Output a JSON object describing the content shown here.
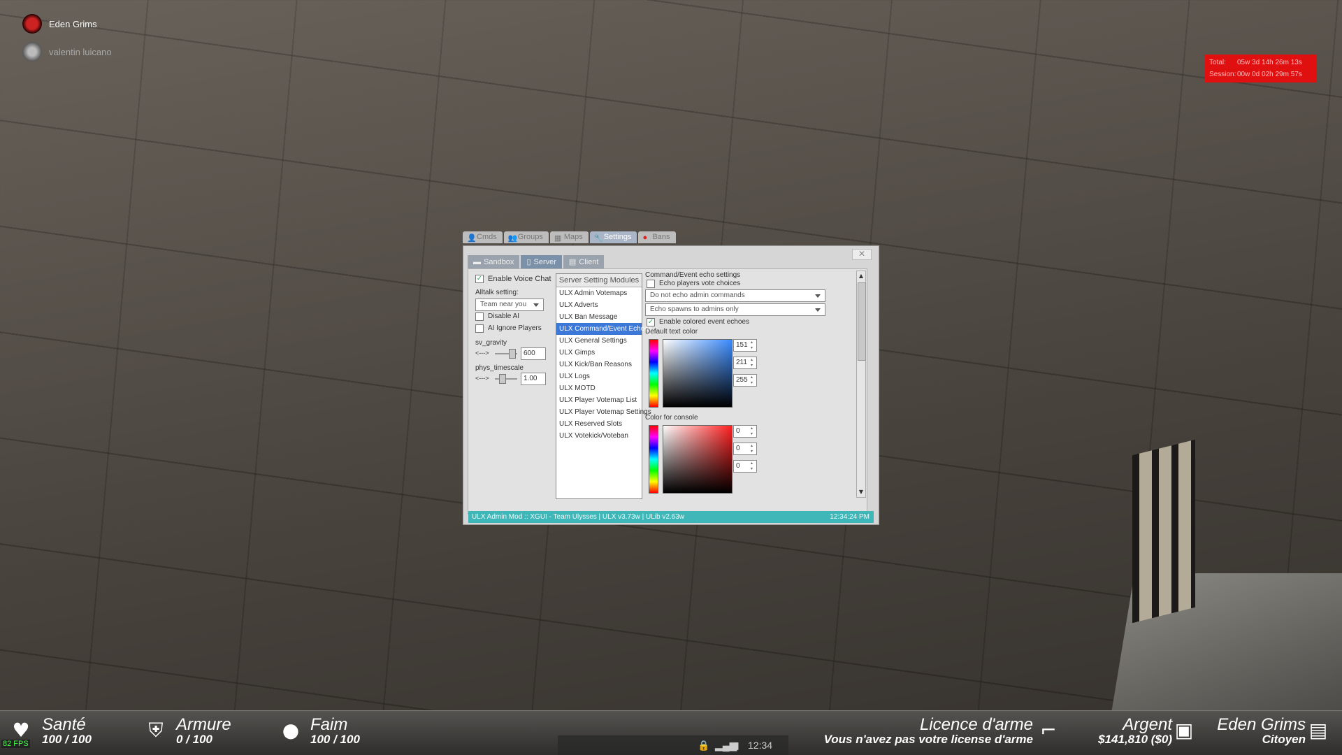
{
  "voice": {
    "speakers": [
      {
        "name": "Eden Grims"
      },
      {
        "name": "valentin luicano"
      }
    ]
  },
  "playtime": {
    "total_label": "Total:",
    "total_value": "05w 3d 14h 26m 13s",
    "session_label": "Session:",
    "session_value": "00w 0d 02h 29m 57s"
  },
  "xgui": {
    "tabs": [
      {
        "label": "Cmds"
      },
      {
        "label": "Groups"
      },
      {
        "label": "Maps"
      },
      {
        "label": "Settings"
      },
      {
        "label": "Bans"
      }
    ],
    "subtabs": [
      {
        "label": "Sandbox"
      },
      {
        "label": "Server"
      },
      {
        "label": "Client"
      }
    ],
    "close": "✕",
    "left": {
      "voice_chat": "Enable Voice Chat",
      "alltalk_label": "Alltalk setting:",
      "alltalk_value": "Team near you",
      "disable_ai": "Disable AI",
      "ai_ignore": "AI Ignore Players",
      "gravity_label": "sv_gravity",
      "gravity_arrow": "<--->",
      "gravity_value": "600",
      "timescale_label": "phys_timescale",
      "timescale_arrow": "<--->",
      "timescale_value": "1.00"
    },
    "modules": {
      "header": "Server Setting Modules",
      "items": [
        "ULX Admin Votemaps",
        "ULX Adverts",
        "ULX Ban Message",
        "ULX Command/Event Echoes",
        "ULX General Settings",
        "ULX Gimps",
        "ULX Kick/Ban Reasons",
        "ULX Logs",
        "ULX MOTD",
        "ULX Player Votemap List",
        "ULX Player Votemap Settings",
        "ULX Reserved Slots",
        "ULX Votekick/Voteban"
      ],
      "selected": "ULX Command/Event Echoes"
    },
    "echo": {
      "title": "Command/Event echo settings",
      "vote_choices": "Echo players vote choices",
      "admin_dropdown": "Do not echo admin commands",
      "spawn_dropdown": "Echo spawns to admins only",
      "colored": "Enable colored event echoes",
      "text_color_label": "Default text color",
      "text_r": "151",
      "text_g": "211",
      "text_b": "255",
      "console_label": "Color for console",
      "con_r": "0",
      "con_g": "0",
      "con_b": "0"
    },
    "status": {
      "text": "ULX Admin Mod :: XGUI - Team Ulysses  |  ULX v3.73w  |  ULib v2.63w",
      "time": "12:34:24 PM"
    }
  },
  "hud": {
    "fps": "82 FPS",
    "health": {
      "title": "Santé",
      "value": "100 / 100"
    },
    "armor": {
      "title": "Armure",
      "value": "0 / 100"
    },
    "hunger": {
      "title": "Faim",
      "value": "100 / 100"
    },
    "license": {
      "title": "Licence d'arme",
      "value": "Vous n'avez pas votre license d'arme"
    },
    "money": {
      "title": "Argent",
      "value": "$141,810 ($0)"
    },
    "player": {
      "title": "Eden Grims",
      "value": "Citoyen"
    },
    "clock": "12:34"
  },
  "colors": {
    "selection": "#3c78d8",
    "statusbar": "#3fb6b8",
    "playtime_bg": "#e01010"
  }
}
